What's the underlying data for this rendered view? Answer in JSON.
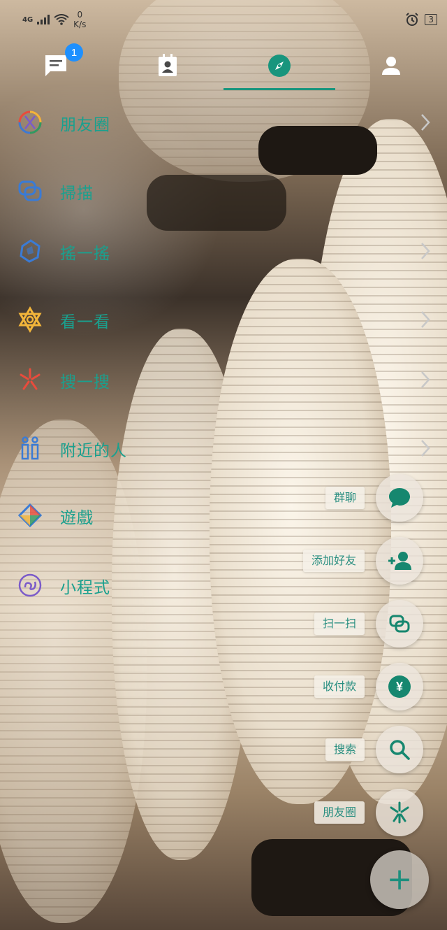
{
  "status_bar": {
    "network": "4G",
    "speed_value": "0",
    "speed_unit": "K/s",
    "battery": "3"
  },
  "tabs": [
    {
      "name": "chats",
      "icon": "chat-icon",
      "badge": "1",
      "active": false
    },
    {
      "name": "contacts",
      "icon": "contacts-icon",
      "active": false
    },
    {
      "name": "discover",
      "icon": "compass-icon",
      "active": true
    },
    {
      "name": "me",
      "icon": "person-icon",
      "active": false
    }
  ],
  "menu": {
    "items": [
      {
        "label": "朋友圈",
        "icon": "moments-icon"
      },
      {
        "label": "掃描",
        "icon": "scan-icon"
      },
      {
        "label": "搖一搖",
        "icon": "shake-icon"
      },
      {
        "label": "看一看",
        "icon": "top-stories-icon"
      },
      {
        "label": "搜一搜",
        "icon": "search-sparkle-icon"
      },
      {
        "label": "附近的人",
        "icon": "nearby-people-icon"
      },
      {
        "label": "遊戲",
        "icon": "games-icon"
      },
      {
        "label": "小程式",
        "icon": "mini-program-icon"
      }
    ]
  },
  "speed_dial": {
    "items": [
      {
        "label": "群聊",
        "icon": "group-chat-icon"
      },
      {
        "label": "添加好友",
        "icon": "add-friend-icon"
      },
      {
        "label": "扫一扫",
        "icon": "scan-icon"
      },
      {
        "label": "收付款",
        "icon": "yuan-icon",
        "glyph": "¥"
      },
      {
        "label": "搜索",
        "icon": "search-icon"
      },
      {
        "label": "朋友圈",
        "icon": "moments-icon"
      }
    ],
    "fab_glyph": "+"
  },
  "colors": {
    "accent": "#18957d",
    "badge": "#1e90ff"
  }
}
